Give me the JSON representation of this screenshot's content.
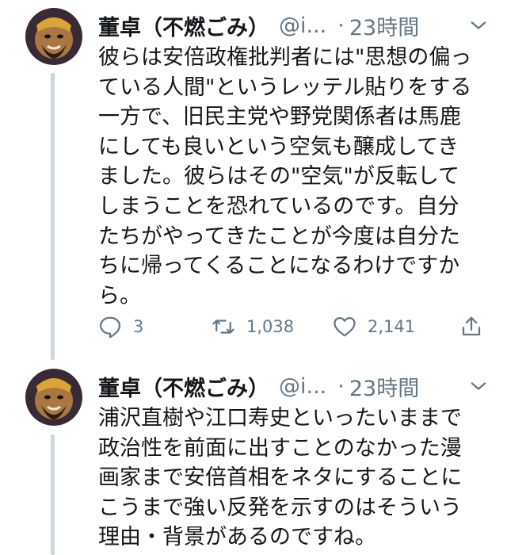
{
  "tweets": [
    {
      "author_name": "董卓（不燃ごみ）",
      "handle": "@i...",
      "separator": "·",
      "time": "23時間",
      "lines": [
        "彼らは安倍政権批判者には\"思想の偏っ",
        "ている人間\"というレッテル貼りをする",
        "一方で、旧民主党や野党関係者は馬鹿",
        "にしても良いという空気も醸成してき",
        "ました。彼らはその\"空気\"が反転して",
        "しまうことを恐れているのです。自分",
        "たちがやってきたことが今度は自分た",
        "ちに帰ってくることになるわけですか",
        "ら。"
      ],
      "replies": "3",
      "retweets": "1,038",
      "likes": "2,141"
    },
    {
      "author_name": "董卓（不燃ごみ）",
      "handle": "@i...",
      "separator": "·",
      "time": "23時間",
      "lines": [
        "浦沢直樹や江口寿史といったいままで",
        "政治性を前面に出すことのなかった漫",
        "画家まで安倍首相をネタにすることに",
        "こうまで強い反発を示すのはそういう",
        "理由・背景があるのですね。"
      ]
    }
  ],
  "icons": {
    "reply": "reply-icon",
    "retweet": "retweet-icon",
    "like": "heart-icon",
    "share": "share-icon",
    "caret": "chevron-down-icon"
  },
  "colors": {
    "text": "#14171a",
    "secondary": "#657786",
    "thread_line": "#ccd6dd"
  }
}
